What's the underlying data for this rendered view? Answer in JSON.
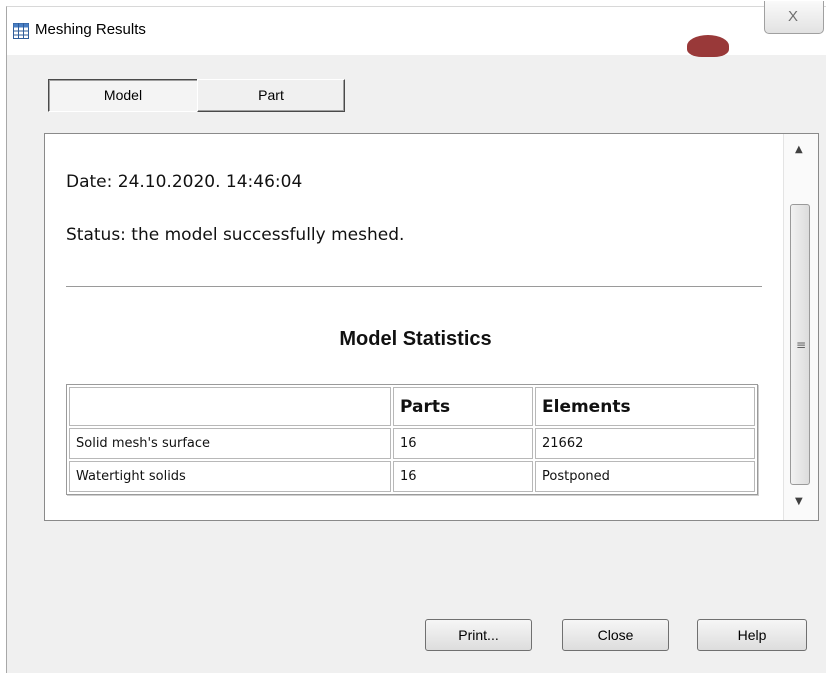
{
  "window": {
    "title": "Meshing Results",
    "close_glyph": "X"
  },
  "tabs": [
    {
      "label": "Model",
      "selected": true
    },
    {
      "label": "Part",
      "selected": false
    }
  ],
  "report": {
    "date_line": "Date: 24.10.2020. 14:46:04",
    "status_line": "Status: the model successfully meshed.",
    "stats_title": "Model Statistics",
    "table": {
      "headers": [
        "",
        "Parts",
        "Elements"
      ],
      "rows": [
        [
          "Solid mesh's surface",
          "16",
          "21662"
        ],
        [
          "Watertight solids",
          "16",
          "Postponed"
        ]
      ]
    }
  },
  "buttons": {
    "print": "Print...",
    "close": "Close",
    "help": "Help"
  },
  "icons": {
    "title": "table-grid-icon",
    "scroll_up": "arrow-up-icon",
    "scroll_down": "arrow-down-icon",
    "scroll_grip": "grip-icon"
  }
}
